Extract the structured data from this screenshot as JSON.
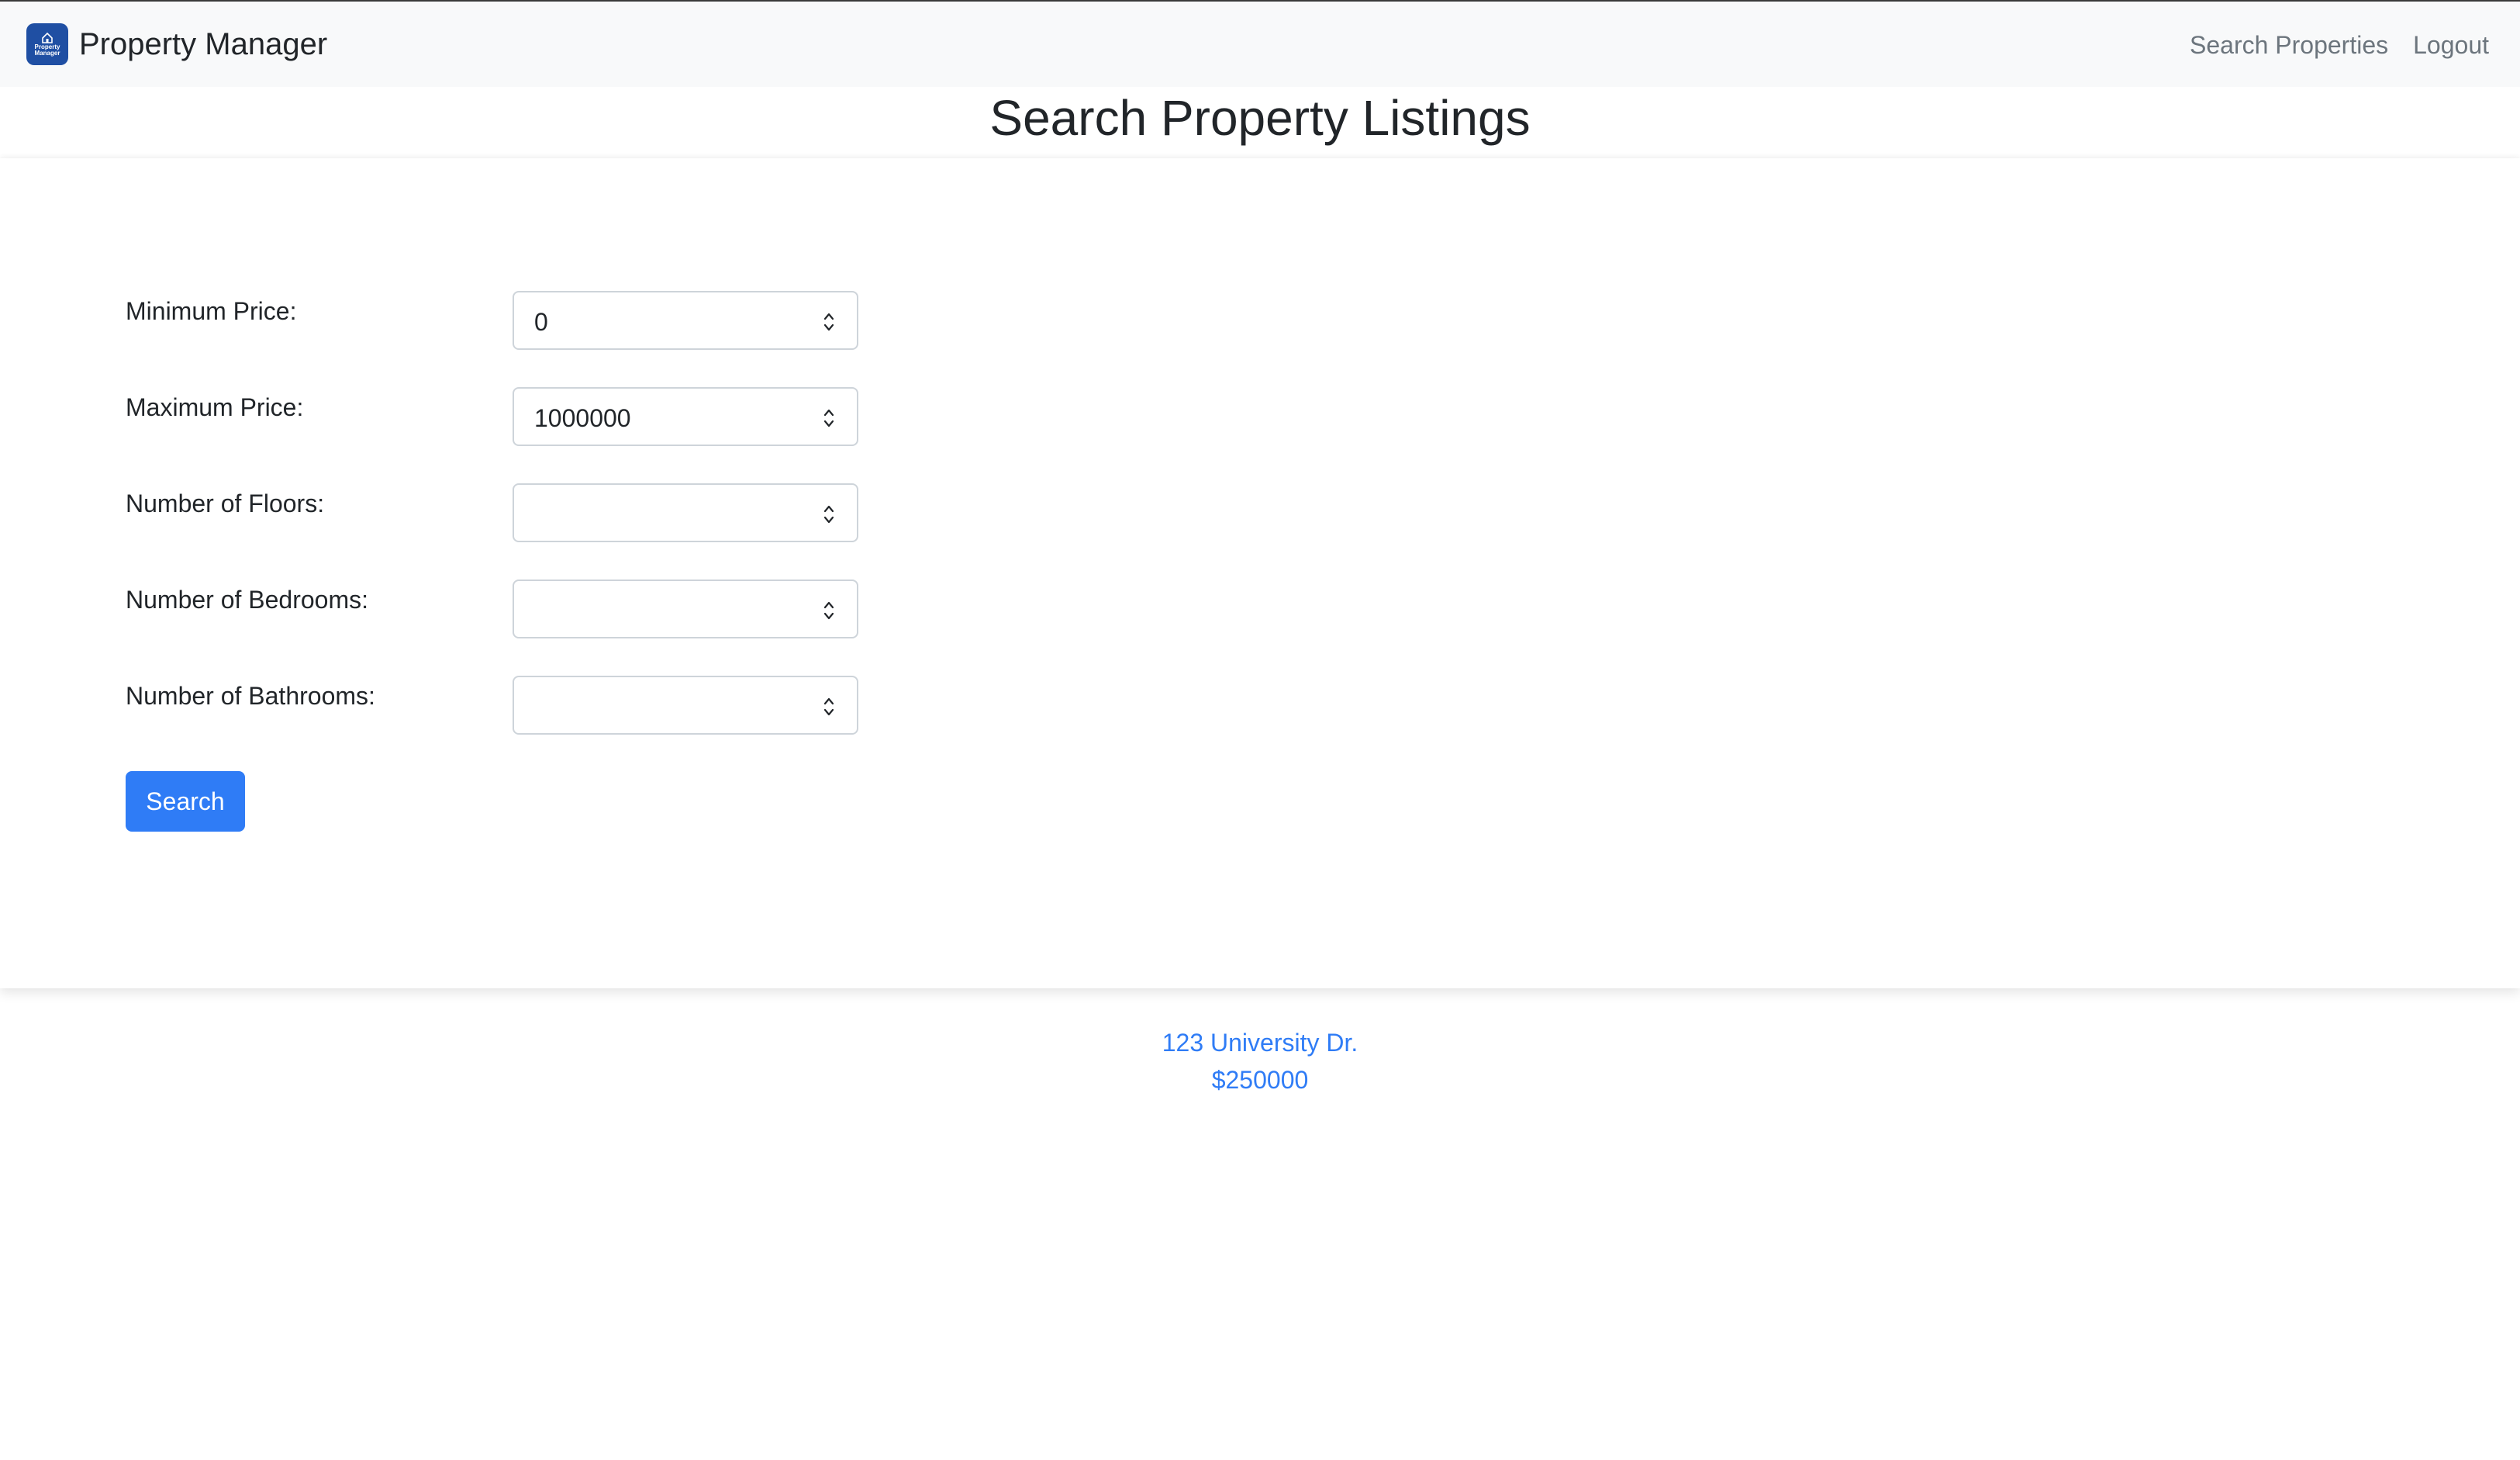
{
  "navbar": {
    "brand_name": "Property Manager",
    "logo_text": "Property Manager",
    "links": [
      {
        "label": "Search Properties"
      },
      {
        "label": "Logout"
      }
    ]
  },
  "page": {
    "title": "Search Property Listings"
  },
  "form": {
    "fields": [
      {
        "label": "Minimum Price:",
        "value": "0"
      },
      {
        "label": "Maximum Price:",
        "value": "1000000"
      },
      {
        "label": "Number of Floors:",
        "value": ""
      },
      {
        "label": "Number of Bedrooms:",
        "value": ""
      },
      {
        "label": "Number of Bathrooms:",
        "value": ""
      }
    ],
    "search_label": "Search"
  },
  "results": [
    {
      "address": "123 University Dr.",
      "price": "$250000"
    }
  ],
  "colors": {
    "primary": "#2f7cf6",
    "navbar_bg": "#f8f9fa",
    "logo_bg": "#1f4fa3",
    "nav_link": "#6c757d"
  }
}
